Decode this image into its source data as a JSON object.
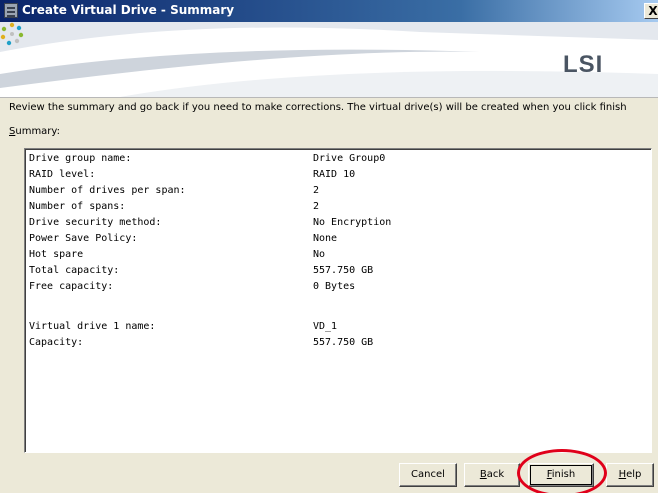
{
  "window": {
    "title": "Create Virtual Drive - Summary",
    "close_label": "X"
  },
  "banner": {
    "logo_text": "LSI",
    "logo_colors": [
      "#e0b020",
      "#1fa0c8",
      "#8ab830",
      "#c0c0c0"
    ]
  },
  "instructions": "Review the summary and go back if you need to make corrections. The virtual drive(s) will be created when you click finish",
  "summary": {
    "label": "Summary:",
    "label_mnemonic": "S",
    "label_rest": "ummary:",
    "rows": [
      {
        "key": "Drive group name:",
        "value": "Drive Group0"
      },
      {
        "key": "RAID level:",
        "value": "RAID 10"
      },
      {
        "key": "Number of drives per span:",
        "value": "2"
      },
      {
        "key": "Number of spans:",
        "value": "2"
      },
      {
        "key": "Drive security method:",
        "value": "No Encryption"
      },
      {
        "key": "Power Save Policy:",
        "value": "None"
      },
      {
        "key": "Hot spare",
        "value": "No"
      },
      {
        "key": "Total capacity:",
        "value": "557.750 GB"
      },
      {
        "key": "Free capacity:",
        "value": "0 Bytes"
      },
      {
        "key": "",
        "value": ""
      },
      {
        "key": "Virtual drive 1 name:",
        "value": "VD_1"
      },
      {
        "key": "Capacity:",
        "value": "557.750 GB"
      }
    ]
  },
  "buttons": {
    "cancel": "Cancel",
    "back": {
      "mnemonic": "B",
      "rest": "ack"
    },
    "finish": {
      "mnemonic": "F",
      "rest": "inish"
    },
    "help": {
      "mnemonic": "H",
      "rest": "elp"
    }
  },
  "annotation_color": "#e0001a"
}
